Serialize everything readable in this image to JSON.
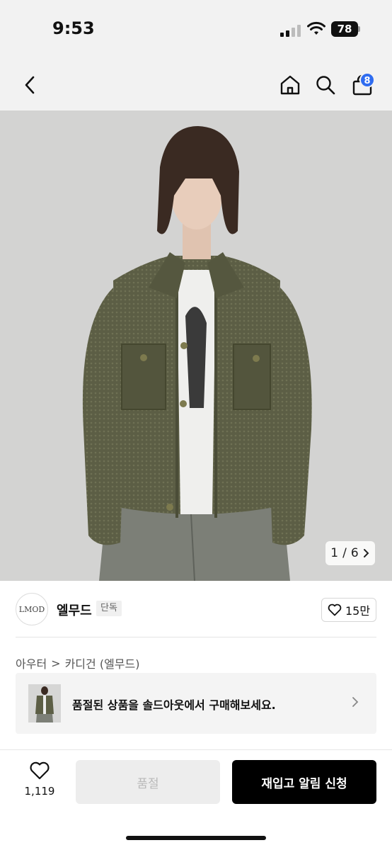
{
  "status_bar": {
    "time": "9:53",
    "battery": "78"
  },
  "nav": {
    "cart_badge": "8"
  },
  "gallery": {
    "current": "1",
    "separator": "/",
    "total": "6"
  },
  "brand": {
    "logo_text": "LMOD",
    "name": "엘무드",
    "tag": "단독",
    "likes": "15만"
  },
  "breadcrumb": {
    "level1": "아우터",
    "sep": ">",
    "level2": "카디건 (엘무드)"
  },
  "banner": {
    "text": "품절된 상품을 솔드아웃에서 구매해보세요."
  },
  "bottom": {
    "wish_count": "1,119",
    "soldout_label": "품절",
    "restock_label": "재입고 알림 신청"
  },
  "colors": {
    "accent_badge": "#2f6cf0",
    "cardigan": "#5c5e45",
    "primary_button": "#000000"
  }
}
